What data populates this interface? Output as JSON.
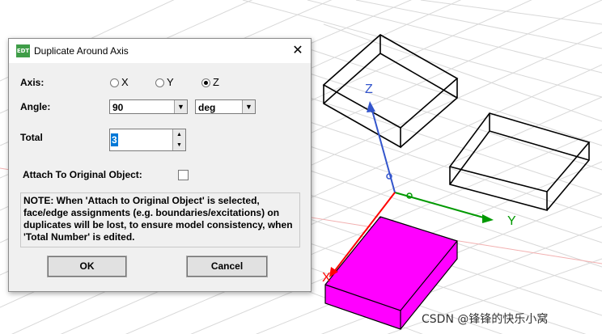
{
  "dialog": {
    "title": "Duplicate Around Axis",
    "app_icon_text": "EDT",
    "close_glyph": "✕",
    "axis_label": "Axis:",
    "axis_options": [
      "X",
      "Y",
      "Z"
    ],
    "axis_selected": "Z",
    "angle_label": "Angle:",
    "angle_value": "90",
    "angle_unit": "deg",
    "total_label": "Total",
    "total_value": "3",
    "attach_label": "Attach To Original Object:",
    "attach_checked": false,
    "note": "NOTE:  When 'Attach to Original Object' is selected, face/edge assignments (e.g. boundaries/excitations) on duplicates will be lost, to ensure model consistency, when 'Total Number' is edited.",
    "ok_label": "OK",
    "cancel_label": "Cancel"
  },
  "viewport": {
    "axis_labels": {
      "x": "X",
      "y": "Y",
      "z": "Z"
    },
    "colors": {
      "x_axis": "#ff0000",
      "y_axis": "#009900",
      "z_axis": "#3355cc",
      "solid": "#ff00ff",
      "grid": "#d6d6d6"
    }
  },
  "watermark": "CSDN @锋锋的快乐小窝"
}
